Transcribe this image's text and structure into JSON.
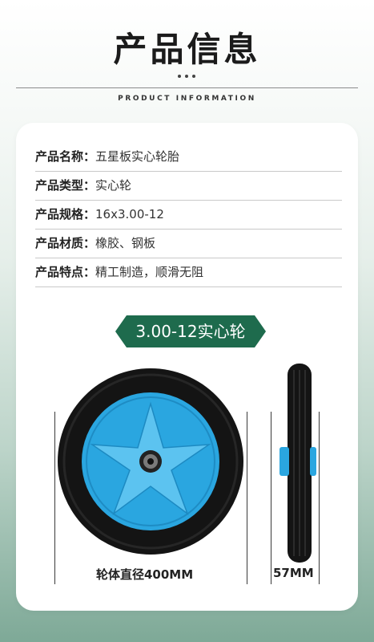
{
  "header": {
    "title": "产品信息",
    "subtitle": "PRODUCT INFORMATION"
  },
  "info_rows": [
    {
      "label": "产品名称：",
      "value": "五星板实心轮胎"
    },
    {
      "label": "产品类型：",
      "value": "实心轮"
    },
    {
      "label": "产品规格：",
      "value": "16x3.00-12"
    },
    {
      "label": "产品材质：",
      "value": "橡胶、钢板"
    },
    {
      "label": "产品特点：",
      "value": "精工制造，顺滑无阻"
    }
  ],
  "badge": {
    "text": "3.00-12实心轮"
  },
  "dimensions": {
    "diameter_label": "轮体直径400MM",
    "width_label": "57MM"
  },
  "colors": {
    "accent": "#1e6b4d",
    "rim": "#2aa6e0",
    "tire": "#141414"
  }
}
